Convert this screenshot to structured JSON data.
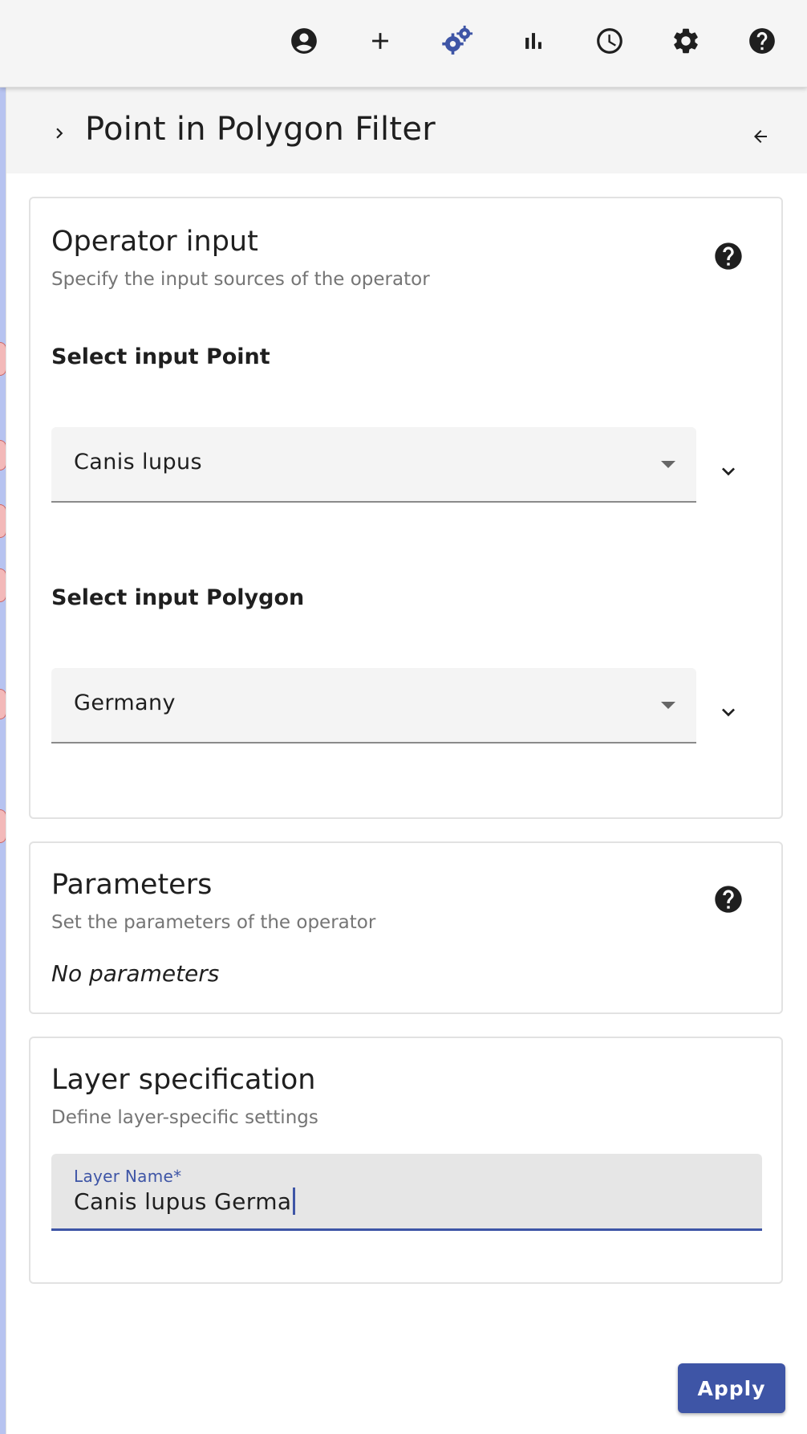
{
  "toolbar": {
    "icons": [
      {
        "name": "account-circle-icon"
      },
      {
        "name": "add-icon"
      },
      {
        "name": "operators-gears-icon",
        "active": true
      },
      {
        "name": "bar-chart-icon"
      },
      {
        "name": "history-clock-icon"
      },
      {
        "name": "settings-gear-icon"
      },
      {
        "name": "help-icon"
      }
    ],
    "active_color": "#3e55a6",
    "icon_color": "#1f1f1f"
  },
  "panel": {
    "title": "Point in Polygon Filter"
  },
  "operator_input": {
    "title": "Operator input",
    "subtitle": "Specify the input sources of the operator",
    "point_label": "Select input Point",
    "point_value": "Canis lupus",
    "polygon_label": "Select input Polygon",
    "polygon_value": "Germany"
  },
  "parameters": {
    "title": "Parameters",
    "subtitle": "Set the parameters of the operator",
    "empty_text": "No parameters"
  },
  "layer_spec": {
    "title": "Layer specification",
    "subtitle": "Define layer-specific settings",
    "name_label": "Layer Name*",
    "name_value": "Canis lupus Germa"
  },
  "actions": {
    "apply_label": "Apply",
    "accent_color": "#3e55a6"
  }
}
